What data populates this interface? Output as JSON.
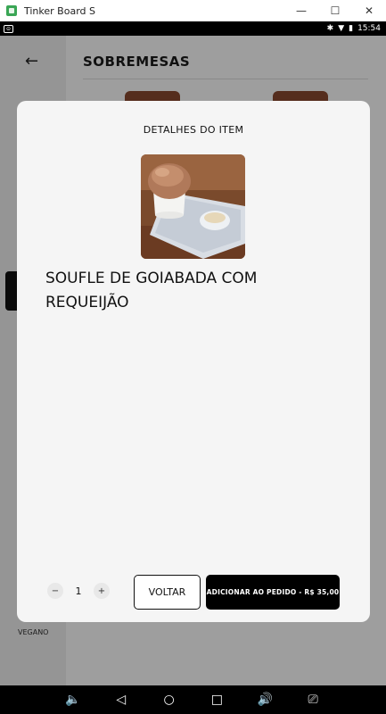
{
  "window": {
    "title": "Tinker Board S"
  },
  "status_bar": {
    "time": "15:54"
  },
  "screen": {
    "title": "SOBREMESAS"
  },
  "sidebar": {
    "visible_label": "VEGANO"
  },
  "modal": {
    "heading": "DETALHES DO ITEM",
    "item_name": "SOUFLE DE GOIABADA COM REQUEIJÃO",
    "quantity": "1",
    "decrement_label": "−",
    "increment_label": "+",
    "back_label": "VOLTAR",
    "add_label": "ADICIONAR AO PEDIDO - R$ 35,00"
  },
  "icons": [
    "app-icon",
    "minimize-icon",
    "maximize-icon",
    "close-icon",
    "back-arrow-icon",
    "bluetooth-icon",
    "wifi-icon",
    "battery-icon",
    "volume-down-icon",
    "back-icon",
    "home-icon",
    "recents-icon",
    "volume-up-icon",
    "screenshot-icon"
  ]
}
